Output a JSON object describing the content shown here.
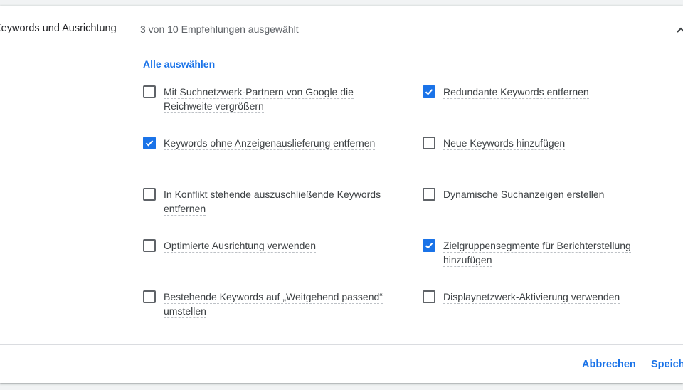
{
  "section": {
    "title": "Keywords und Ausrichtung",
    "summary": "3 von 10 Empfehlungen ausgewählt",
    "collapse_icon": "chevron-up-icon"
  },
  "select_all_label": "Alle auswählen",
  "options": [
    {
      "label_line1": "Mit Suchnetzwerk-Partnern von Google die",
      "label_line2": "Reichweite vergrößern",
      "checked": false
    },
    {
      "label_line1": "Redundante Keywords entfernen",
      "label_line2": "",
      "checked": true
    },
    {
      "label_line1": "Keywords ohne Anzeigenauslieferung entfernen",
      "label_line2": "",
      "checked": true
    },
    {
      "label_line1": "Neue Keywords hinzufügen",
      "label_line2": "",
      "checked": false
    },
    {
      "label_line1": "In Konflikt stehende auszuschließende Keywords",
      "label_line2": "entfernen",
      "checked": false
    },
    {
      "label_line1": "Dynamische Suchanzeigen erstellen",
      "label_line2": "",
      "checked": false
    },
    {
      "label_line1": "Optimierte Ausrichtung verwenden",
      "label_line2": "",
      "checked": false
    },
    {
      "label_line1": "Zielgruppensegmente für Berichterstellung",
      "label_line2": "hinzufügen",
      "checked": true
    },
    {
      "label_line1": "Bestehende Keywords auf „Weitgehend passend“",
      "label_line2": "umstellen",
      "checked": false
    },
    {
      "label_line1": "Displaynetzwerk-Aktivierung verwenden",
      "label_line2": "",
      "checked": false
    }
  ],
  "footer": {
    "cancel_label": "Abbrechen",
    "save_label": "Speichern"
  },
  "colors": {
    "accent": "#1a73e8",
    "text": "#3c4043",
    "muted": "#5f6368"
  }
}
